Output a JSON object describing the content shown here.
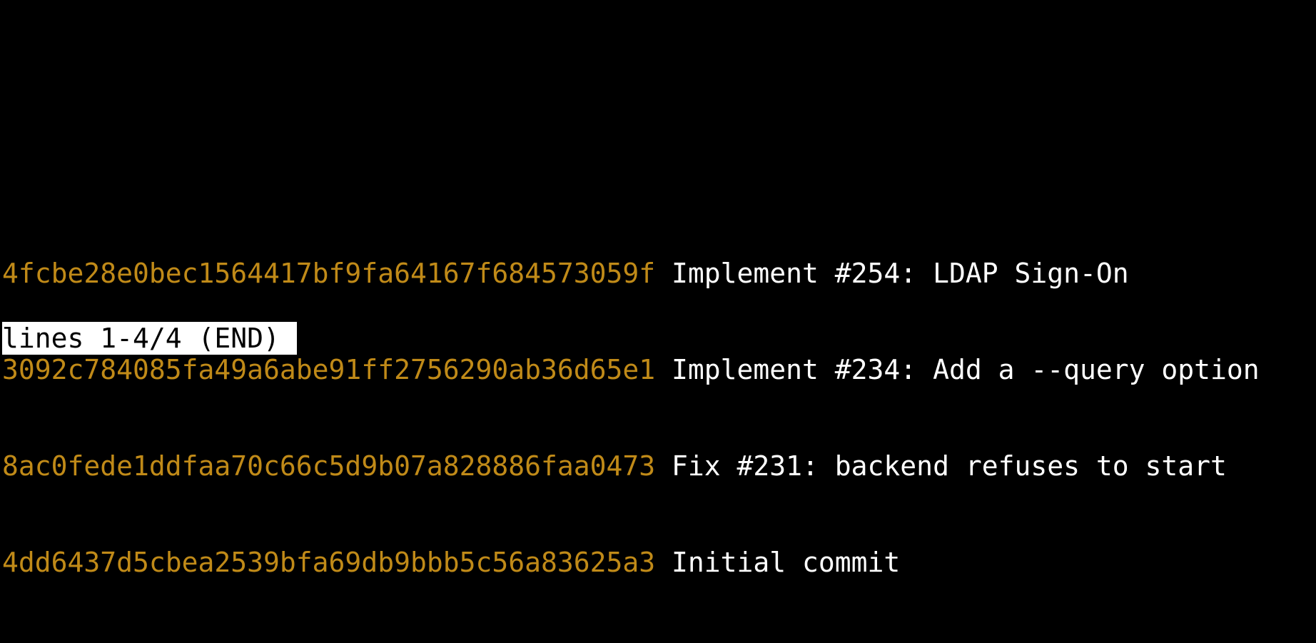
{
  "colors": {
    "background": "#000000",
    "hash": "#c08a18",
    "message": "#ffffff",
    "status_bg": "#ffffff",
    "status_fg": "#000000"
  },
  "log": {
    "entries": [
      {
        "hash": "4fcbe28e0bec1564417bf9fa64167f684573059f",
        "message": "Implement #254: LDAP Sign-On"
      },
      {
        "hash": "3092c784085fa49a6abe91ff2756290ab36d65e1",
        "message": "Implement #234: Add a --query option"
      },
      {
        "hash": "8ac0fede1ddfaa70c66c5d9b07a828886faa0473",
        "message": "Fix #231: backend refuses to start"
      },
      {
        "hash": "4dd6437d5cbea2539bfa69db9bbb5c56a83625a3",
        "message": "Initial commit"
      }
    ]
  },
  "pager": {
    "status": "lines 1-4/4 (END)"
  }
}
